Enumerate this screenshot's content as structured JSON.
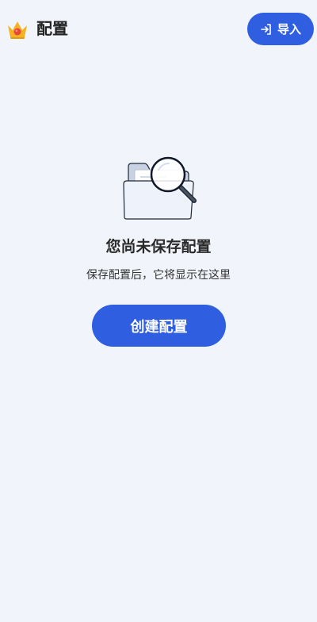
{
  "header": {
    "title": "配置",
    "logo_icon": "crown-icon",
    "import_button": {
      "label": "导入",
      "icon": "import-icon"
    }
  },
  "empty_state": {
    "illustration_icon": "folder-search-icon",
    "title": "您尚未保存配置",
    "subtitle": "保存配置后，它将显示在这里",
    "create_button_label": "创建配置"
  },
  "colors": {
    "background": "#f1f4fa",
    "accent": "#2f5fe0"
  }
}
